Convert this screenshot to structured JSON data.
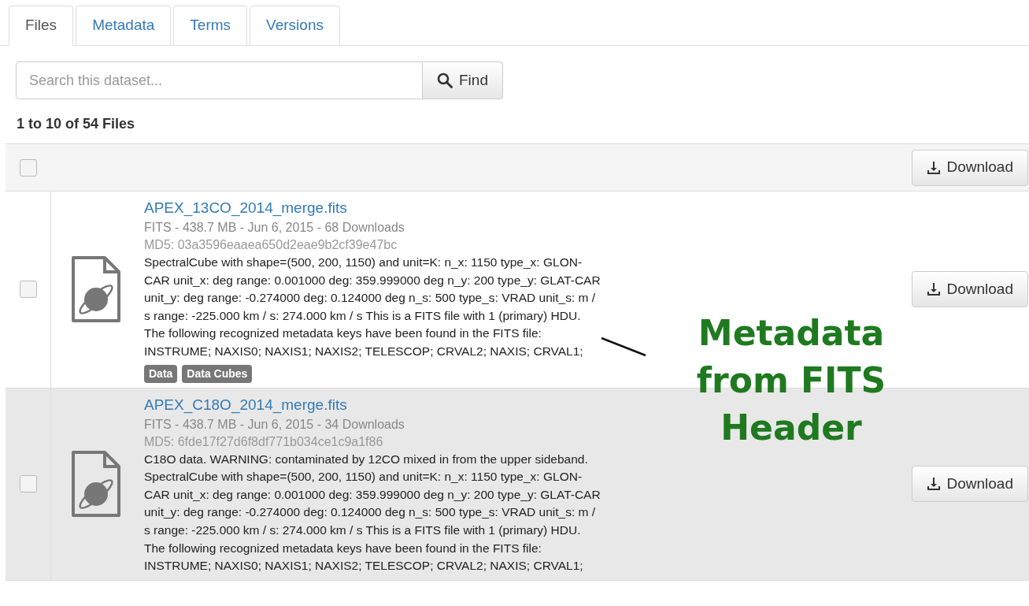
{
  "tabs": [
    {
      "label": "Files",
      "selected": true
    },
    {
      "label": "Metadata",
      "selected": false
    },
    {
      "label": "Terms",
      "selected": false
    },
    {
      "label": "Versions",
      "selected": false
    }
  ],
  "search": {
    "placeholder": "Search this dataset...",
    "button": "Find"
  },
  "count": "1 to 10 of 54 Files",
  "header": {
    "checked": false,
    "download": "Download"
  },
  "files": [
    {
      "name": "APEX_13CO_2014_merge.fits",
      "info": "FITS - 438.7 MB - Jun 6, 2015 - 68 Downloads",
      "md5": "MD5: 03a3596eaaea650d2eae9b2cf39e47bc",
      "description": "SpectralCube with shape=(500, 200, 1150) and unit=K: n_x: 1150 type_x: GLON-CAR unit_x: deg range: 0.001000 deg: 359.999000 deg n_y: 200 type_y: GLAT-CAR unit_y: deg range: -0.274000 deg: 0.124000 deg n_s: 500 type_s: VRAD unit_s: m / s range: -225.000 km / s: 274.000 km / s This is a FITS file with 1 (primary) HDU. The following recognized metadata keys have been found in the FITS file: INSTRUME; NAXIS0; NAXIS1; NAXIS2; TELESCOP; CRVAL2; NAXIS; CRVAL1;",
      "tags": [
        "Data",
        "Data Cubes"
      ],
      "checked": false,
      "highlighted": false,
      "download": "Download"
    },
    {
      "name": "APEX_C18O_2014_merge.fits",
      "info": "FITS - 438.7 MB - Jun 6, 2015 - 34 Downloads",
      "md5": "MD5: 6fde17f27d6f8df771b034ce1c9a1f86",
      "description": "C18O data. WARNING: contaminated by 12CO mixed in from the upper sideband. SpectralCube with shape=(500, 200, 1150) and unit=K: n_x: 1150 type_x: GLON-CAR unit_x: deg range: 0.001000 deg: 359.999000 deg n_y: 200 type_y: GLAT-CAR unit_y: deg range: -0.274000 deg: 0.124000 deg n_s: 500 type_s: VRAD unit_s: m / s range: -225.000 km / s: 274.000 km / s This is a FITS file with 1 (primary) HDU. The following recognized metadata keys have been found in the FITS file: INSTRUME; NAXIS0; NAXIS1; NAXIS2; TELESCOP; CRVAL2; NAXIS; CRVAL1;",
      "checked": false,
      "highlighted": true,
      "download": "Download"
    }
  ],
  "annotation": "Metadata from FITS Header"
}
